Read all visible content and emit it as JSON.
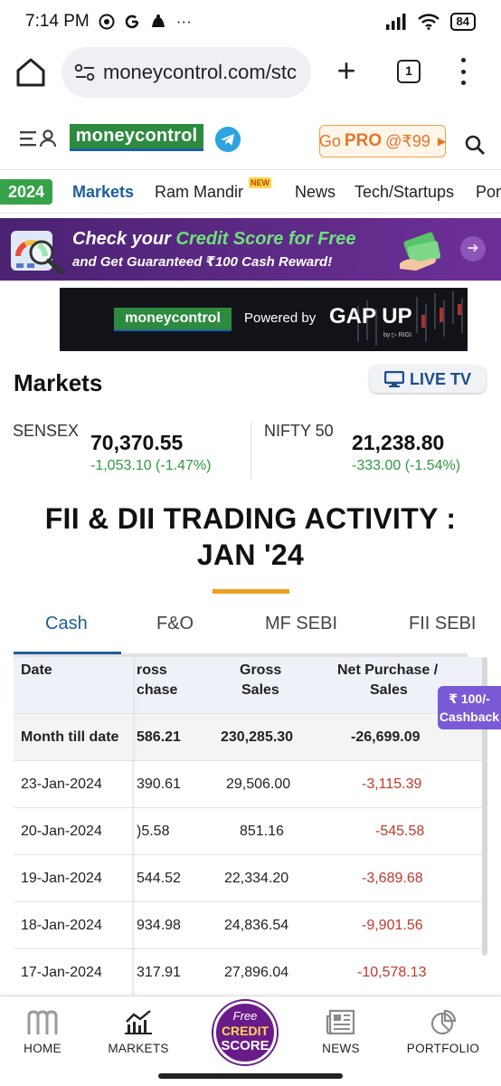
{
  "status_bar": {
    "time": "7:14 PM",
    "ellipsis": "···",
    "battery": "84"
  },
  "browser": {
    "url": "moneycontrol.com/stc",
    "tab_count": "1"
  },
  "header": {
    "logo_text": "moneycontrol",
    "gopro_prefix": "Go",
    "gopro_bold": "PRO",
    "gopro_price": "@₹99"
  },
  "nav": {
    "badge_2024": "2024",
    "items": [
      "Markets",
      "Ram Mandir",
      "News",
      "Tech/Startups",
      "Por"
    ],
    "new_badge": "NEW"
  },
  "credit_banner": {
    "line1_prefix": "Check your",
    "line1_highlight": "Credit Score for Free",
    "line2": "and Get Guaranteed ₹100 Cash Reward!"
  },
  "ad": {
    "logo_text": "moneycontrol",
    "powered_by": "Powered by",
    "brand": "GAP UP",
    "sub": "by ▷ RIGI"
  },
  "markets": {
    "title": "Markets",
    "live_tv": "LIVE TV",
    "sensex": {
      "name": "SENSEX",
      "value": "70,370.55",
      "change": "-1,053.10 (-1.47%)"
    },
    "nifty": {
      "name": "NIFTY 50",
      "value": "21,238.80",
      "change": "-333.00 (-1.54%)"
    }
  },
  "fii": {
    "title_line1": "FII & DII TRADING ACTIVITY :",
    "title_line2": "JAN '24"
  },
  "tabs": [
    "Cash",
    "F&O",
    "MF SEBI",
    "FII SEBI"
  ],
  "table": {
    "headers": {
      "date": "Date",
      "gross_purchase_l1": "ross",
      "gross_purchase_l2": "chase",
      "gross_sales_l1": "Gross",
      "gross_sales_l2": "Sales",
      "net_l1": "Net Purchase /",
      "net_l2": "Sales"
    },
    "month_till_date": {
      "label": "Month till date",
      "gross_purchase": "586.21",
      "gross_sales": "230,285.30",
      "net": "-26,699.09"
    },
    "rows": [
      {
        "date": "23-Jan-2024",
        "gross_purchase": "390.61",
        "gross_sales": "29,506.00",
        "net": "-3,115.39"
      },
      {
        "date": "20-Jan-2024",
        "gross_purchase": ")5.58",
        "gross_sales": "851.16",
        "net": "-545.58"
      },
      {
        "date": "19-Jan-2024",
        "gross_purchase": "544.52",
        "gross_sales": "22,334.20",
        "net": "-3,689.68"
      },
      {
        "date": "18-Jan-2024",
        "gross_purchase": "934.98",
        "gross_sales": "24,836.54",
        "net": "-9,901.56"
      },
      {
        "date": "17-Jan-2024",
        "gross_purchase": "317.91",
        "gross_sales": "27,896.04",
        "net": "-10,578.13"
      }
    ]
  },
  "cashback": {
    "line1": "₹ 100/-",
    "line2": "Cashback"
  },
  "bottom_nav": {
    "home": "HOME",
    "markets": "MARKETS",
    "credit_free": "Free",
    "credit_credit": "CREDIT",
    "credit_score": "SCORE",
    "news": "NEWS",
    "portfolio": "PORTFOLIO"
  },
  "colors": {
    "brand_green": "#2d8b3f",
    "link_blue": "#1f5e98",
    "positive_green": "#2e9a3d",
    "negative_red": "#c0392b",
    "accent_orange": "#f0a020",
    "banner_purple": "#4b2372"
  }
}
